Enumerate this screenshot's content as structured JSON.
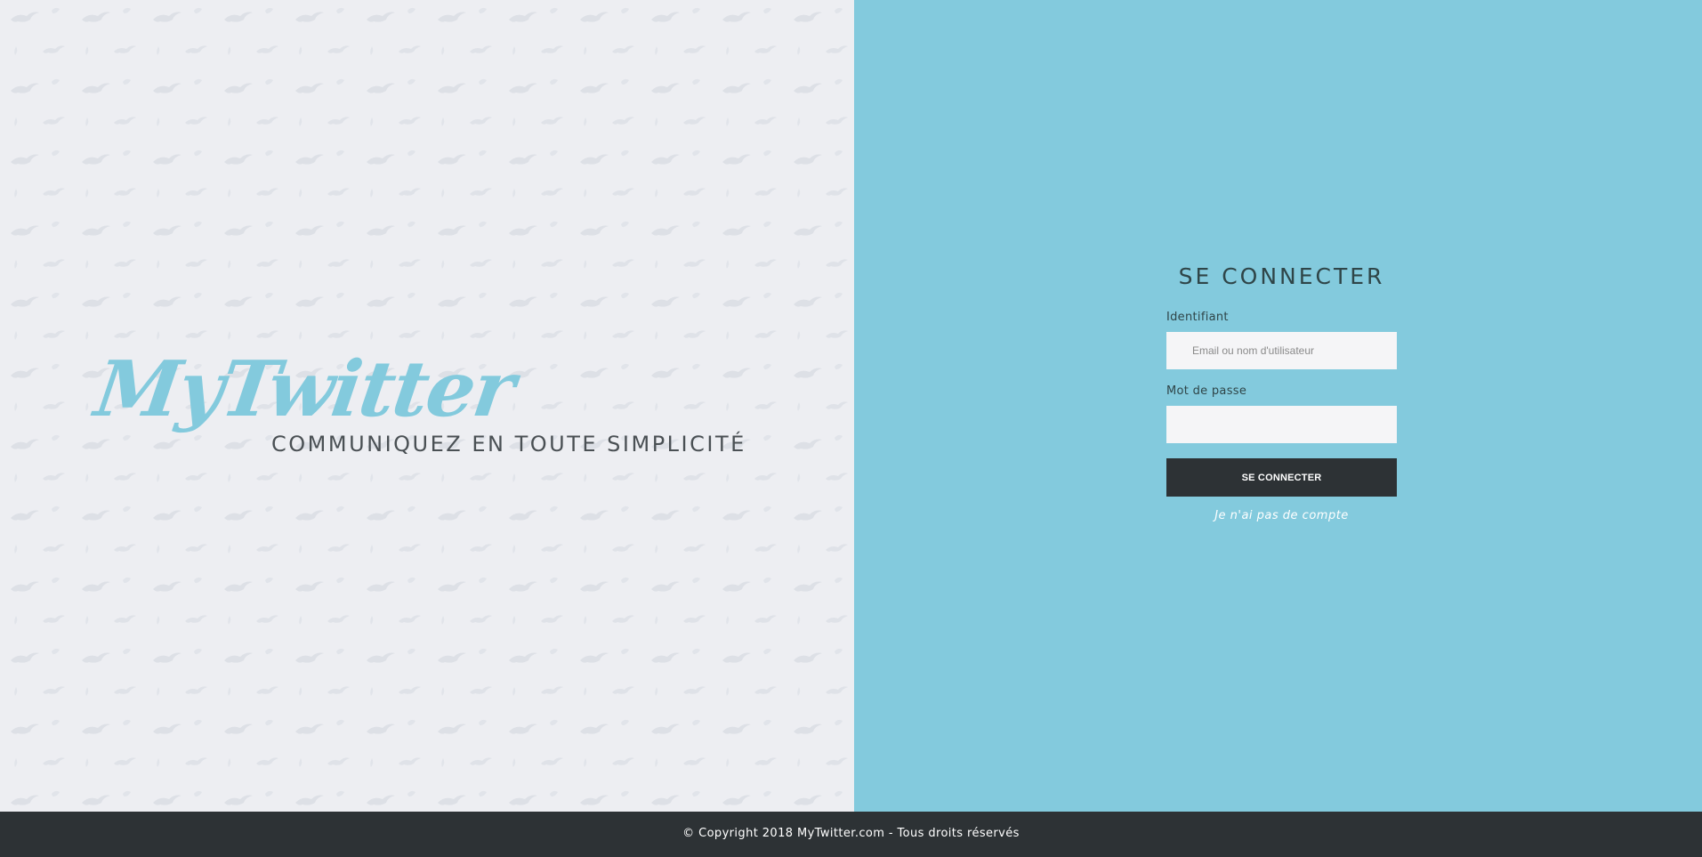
{
  "brand": {
    "logo_text": "MyTwitter",
    "tagline": "COMMUNIQUEZ EN TOUTE SIMPLICITÉ"
  },
  "login": {
    "title": "SE CONNECTER",
    "username_label": "Identifiant",
    "username_placeholder": "Email ou nom d'utilisateur",
    "username_value": "",
    "password_label": "Mot de passe",
    "password_value": "",
    "submit_label": "SE CONNECTER",
    "signup_link": "Je n'ai pas de compte"
  },
  "footer": {
    "text": "© Copyright 2018 MyTwitter.com - Tous droits réservés"
  },
  "colors": {
    "left_background": "#edeef2",
    "right_background": "#83cadd",
    "accent": "#83cadd",
    "dark": "#2d3235",
    "input_background": "#f5f5f7"
  },
  "icons": {
    "background_pattern": "bird-icon"
  }
}
